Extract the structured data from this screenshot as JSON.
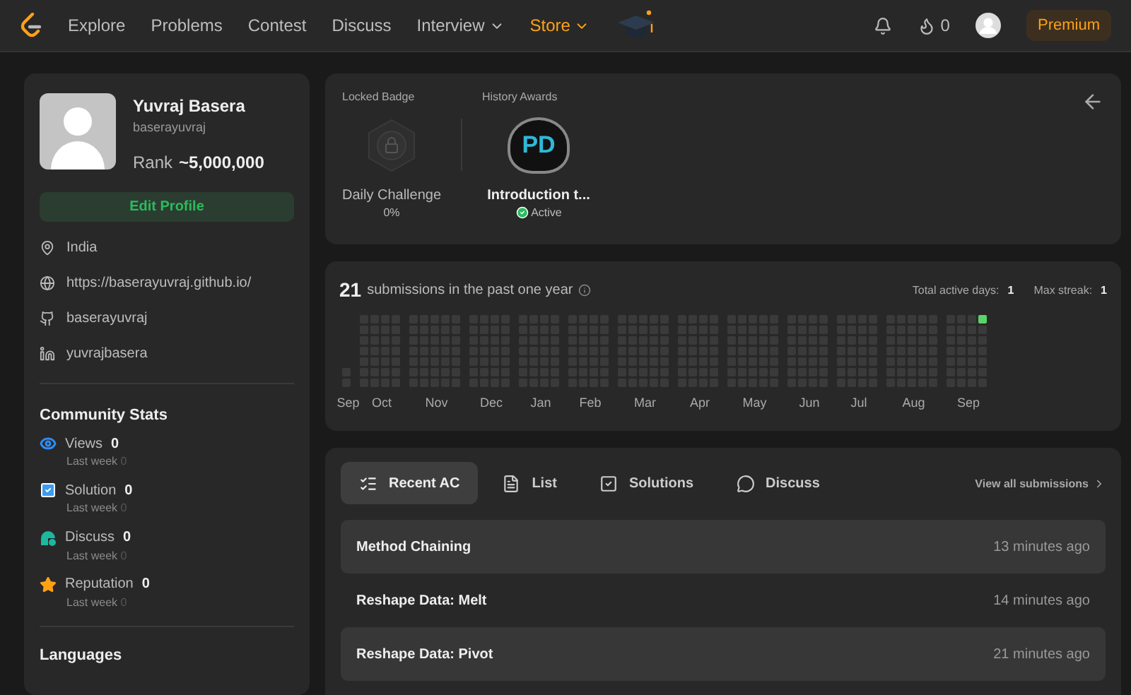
{
  "nav": {
    "items": [
      {
        "label": "Explore",
        "highlighted": false,
        "dropdown": false
      },
      {
        "label": "Problems",
        "highlighted": false,
        "dropdown": false
      },
      {
        "label": "Contest",
        "highlighted": false,
        "dropdown": false
      },
      {
        "label": "Discuss",
        "highlighted": false,
        "dropdown": false
      },
      {
        "label": "Interview",
        "highlighted": false,
        "dropdown": true
      },
      {
        "label": "Store",
        "highlighted": true,
        "dropdown": true
      }
    ],
    "streak": "0",
    "premium": "Premium"
  },
  "profile": {
    "name": "Yuvraj Basera",
    "username": "baserayuvraj",
    "rank_label": "Rank",
    "rank": "~5,000,000",
    "edit_button": "Edit Profile",
    "links": [
      {
        "kind": "location",
        "text": "India"
      },
      {
        "kind": "website",
        "text": "https://baserayuvraj.github.io/"
      },
      {
        "kind": "github",
        "text": "baserayuvraj"
      },
      {
        "kind": "linkedin",
        "text": "yuvrajbasera"
      }
    ]
  },
  "community_stats": {
    "title": "Community Stats",
    "items": [
      {
        "kind": "views",
        "label": "Views",
        "value": "0",
        "sub_label": "Last week",
        "sub_value": "0"
      },
      {
        "kind": "solution",
        "label": "Solution",
        "value": "0",
        "sub_label": "Last week",
        "sub_value": "0"
      },
      {
        "kind": "discuss",
        "label": "Discuss",
        "value": "0",
        "sub_label": "Last week",
        "sub_value": "0"
      },
      {
        "kind": "reputation",
        "label": "Reputation",
        "value": "0",
        "sub_label": "Last week",
        "sub_value": "0"
      }
    ]
  },
  "languages": {
    "title": "Languages"
  },
  "badges": {
    "locked": {
      "heading": "Locked Badge",
      "name": "Daily Challenge",
      "progress": "0%"
    },
    "history": {
      "heading": "History Awards",
      "name": "Introduction t...",
      "badge_text": "PD",
      "status": "Active"
    }
  },
  "activity": {
    "count": "21",
    "text": "submissions in the past one year",
    "active_days_label": "Total active days:",
    "active_days": "1",
    "streak_label": "Max streak:",
    "streak": "1",
    "months": [
      "Sep",
      "Oct",
      "Nov",
      "Dec",
      "Jan",
      "Feb",
      "Mar",
      "Apr",
      "May",
      "Jun",
      "Jul",
      "Aug",
      "Sep"
    ]
  },
  "submissions": {
    "tabs": [
      {
        "kind": "recent",
        "label": "Recent AC",
        "selected": true
      },
      {
        "kind": "list",
        "label": "List",
        "selected": false
      },
      {
        "kind": "solutions",
        "label": "Solutions",
        "selected": false
      },
      {
        "kind": "discuss",
        "label": "Discuss",
        "selected": false
      }
    ],
    "view_all": "View all submissions",
    "rows": [
      {
        "title": "Method Chaining",
        "time": "13 minutes ago"
      },
      {
        "title": "Reshape Data: Melt",
        "time": "14 minutes ago"
      },
      {
        "title": "Reshape Data: Pivot",
        "time": "21 minutes ago"
      }
    ]
  }
}
